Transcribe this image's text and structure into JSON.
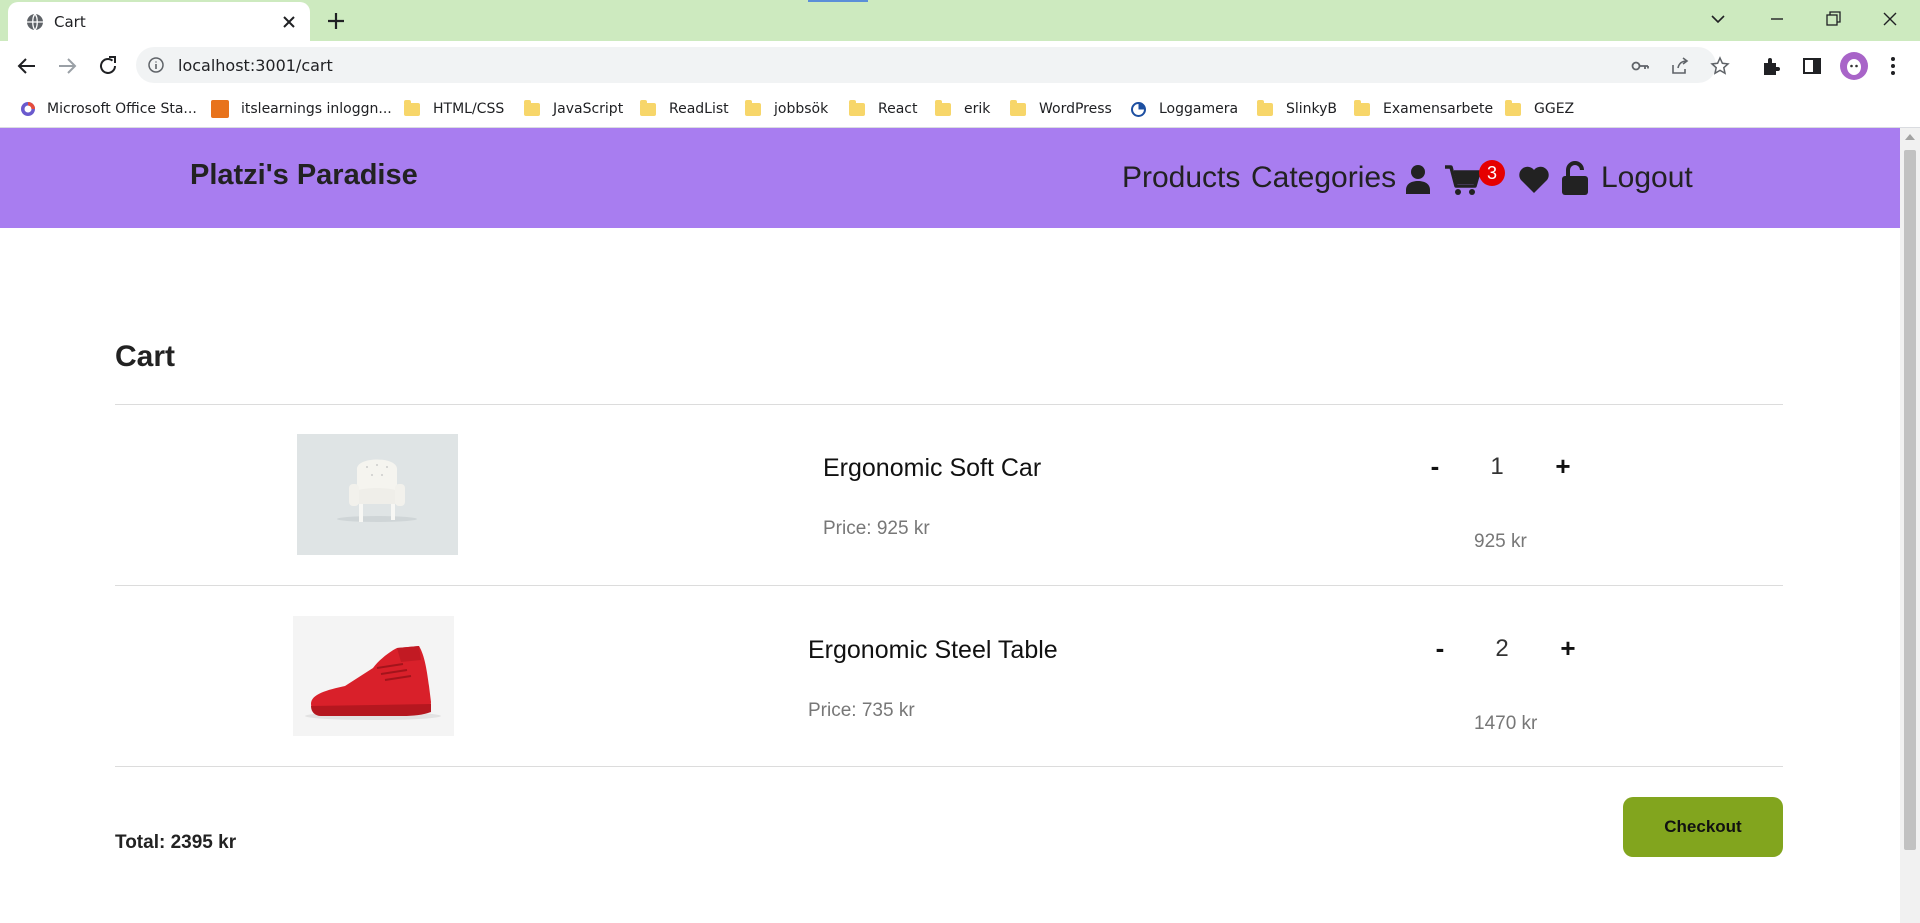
{
  "browser": {
    "tab_title": "Cart",
    "url": "localhost:3001/cart",
    "bookmarks": [
      {
        "label": "Microsoft Office Sta...",
        "icon": "office-icon"
      },
      {
        "label": "itslearnings inloggn...",
        "icon": "its-icon"
      },
      {
        "label": "HTML/CSS",
        "icon": "folder-icon"
      },
      {
        "label": "JavaScript",
        "icon": "folder-icon"
      },
      {
        "label": "ReadList",
        "icon": "folder-icon"
      },
      {
        "label": "jobbsök",
        "icon": "folder-icon"
      },
      {
        "label": "React",
        "icon": "folder-icon"
      },
      {
        "label": "erik",
        "icon": "folder-icon"
      },
      {
        "label": "WordPress",
        "icon": "folder-icon"
      },
      {
        "label": "Loggamera",
        "icon": "loggamera-icon"
      },
      {
        "label": "SlinkyB",
        "icon": "folder-icon"
      },
      {
        "label": "Examensarbete",
        "icon": "folder-icon"
      },
      {
        "label": "GGEZ",
        "icon": "folder-icon"
      }
    ]
  },
  "header": {
    "brand": "Platzi's Paradise",
    "nav": {
      "products": "Products",
      "categories": "Categories",
      "logout": "Logout"
    },
    "cart_count": "3",
    "colors": {
      "header_bg": "#a87df0",
      "badge": "#e60000"
    }
  },
  "cart": {
    "title": "Cart",
    "items": [
      {
        "name": "Ergonomic Soft Car",
        "price": "Price: 925 kr",
        "quantity": "1",
        "line_total": "925 kr",
        "image": "white-chair"
      },
      {
        "name": "Ergonomic Steel Table",
        "price": "Price: 735 kr",
        "quantity": "2",
        "line_total": "1470 kr",
        "image": "red-sneaker"
      }
    ],
    "decrement_label": "-",
    "increment_label": "+",
    "total": "Total: 2395 kr",
    "checkout_label": "Checkout",
    "colors": {
      "checkout_bg": "#82a51e"
    }
  }
}
